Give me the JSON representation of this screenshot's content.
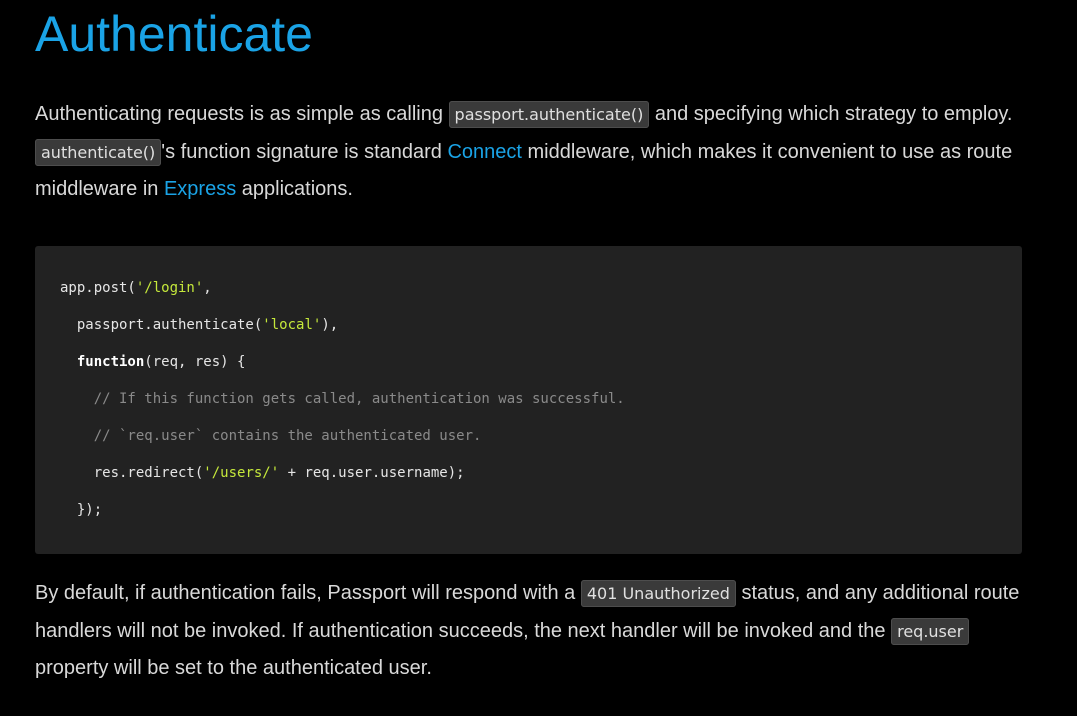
{
  "heading": "Authenticate",
  "intro": {
    "t1": "Authenticating requests is as simple as calling ",
    "code1": "passport.authenticate()",
    "t2": " and specifying which strategy to employ. ",
    "code2": "authenticate()",
    "t3": "'s function signature is standard ",
    "link_connect": "Connect",
    "t4": " middleware, which makes it convenient to use as route middleware in ",
    "link_express": "Express",
    "t5": " applications."
  },
  "code_lines": [
    [
      {
        "t": "app.post(",
        "k": "plain"
      },
      {
        "t": "'/login'",
        "k": "str"
      },
      {
        "t": ",",
        "k": "plain"
      }
    ],
    [
      {
        "t": "  passport.authenticate(",
        "k": "plain"
      },
      {
        "t": "'local'",
        "k": "str"
      },
      {
        "t": "),",
        "k": "plain"
      }
    ],
    [
      {
        "t": "  ",
        "k": "plain"
      },
      {
        "t": "function",
        "k": "kw"
      },
      {
        "t": "(req, res) {",
        "k": "plain"
      }
    ],
    [
      {
        "t": "    // If this function gets called, authentication was successful.",
        "k": "cmt"
      }
    ],
    [
      {
        "t": "    // `req.user` contains the authenticated user.",
        "k": "cmt"
      }
    ],
    [
      {
        "t": "    res.redirect(",
        "k": "plain"
      },
      {
        "t": "'/users/'",
        "k": "str"
      },
      {
        "t": " + req.user.username);",
        "k": "plain"
      }
    ],
    [
      {
        "t": "  });",
        "k": "plain"
      }
    ]
  ],
  "outro": {
    "t1": "By default, if authentication fails, Passport will respond with a ",
    "code1": "401 Unauthorized",
    "t2": " status, and any additional route handlers will not be invoked. If authentication succeeds, the next handler will be invoked and the ",
    "code2": "req.user",
    "t3": " property will be set to the authenticated user."
  },
  "colors": {
    "background": "#000000",
    "heading": "#1aa3e6",
    "link": "#1aa3e6",
    "body_text": "#d9d9d9",
    "code_bg": "#222222",
    "string": "#c5e83b",
    "comment": "#8a8a8a"
  }
}
